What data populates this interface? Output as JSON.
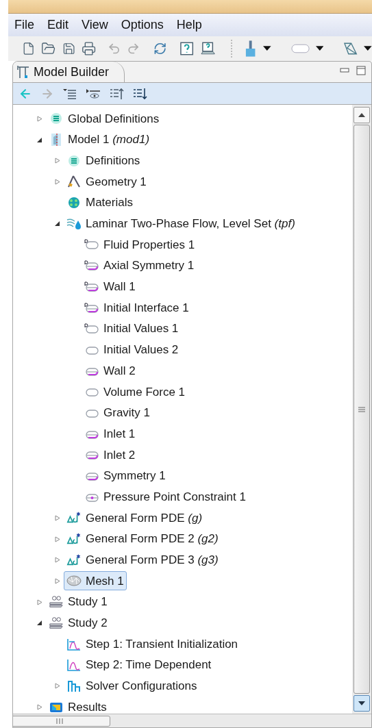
{
  "menu": [
    "File",
    "Edit",
    "View",
    "Options",
    "Help"
  ],
  "panel": {
    "title": "Model Builder"
  },
  "tree": [
    {
      "label": "Global Definitions",
      "kind": "definitions",
      "expanded": false,
      "selected": false
    },
    {
      "label": "Model 1 *(mod1)*",
      "kind": "model",
      "expanded": true,
      "selected": false,
      "children": [
        {
          "label": "Definitions",
          "kind": "definitions",
          "expanded": false,
          "selected": false
        },
        {
          "label": "Geometry 1",
          "kind": "geometry",
          "expanded": false,
          "selected": false
        },
        {
          "label": "Materials",
          "kind": "materials",
          "selected": false
        },
        {
          "label": "Laminar Two-Phase Flow, Level Set *(tpf)*",
          "kind": "physics",
          "expanded": true,
          "selected": false,
          "children": [
            {
              "label": "Fluid Properties 1",
              "kind": "node-default",
              "selected": false
            },
            {
              "label": "Axial Symmetry 1",
              "kind": "boundary-default",
              "selected": false
            },
            {
              "label": "Wall 1",
              "kind": "boundary-default",
              "selected": false
            },
            {
              "label": "Initial Interface 1",
              "kind": "boundary-default",
              "selected": false
            },
            {
              "label": "Initial Values 1",
              "kind": "node-default",
              "selected": false
            },
            {
              "label": "Initial Values 2",
              "kind": "node",
              "selected": false
            },
            {
              "label": "Wall 2",
              "kind": "boundary",
              "selected": false
            },
            {
              "label": "Volume Force 1",
              "kind": "node",
              "selected": false
            },
            {
              "label": "Gravity 1",
              "kind": "node",
              "selected": false
            },
            {
              "label": "Inlet 1",
              "kind": "boundary",
              "selected": false
            },
            {
              "label": "Inlet 2",
              "kind": "boundary",
              "selected": false
            },
            {
              "label": "Symmetry 1",
              "kind": "boundary",
              "selected": false
            },
            {
              "label": "Pressure Point Constraint 1",
              "kind": "point",
              "selected": false
            }
          ]
        },
        {
          "label": "General Form PDE *(g)*",
          "kind": "pde",
          "expanded": false,
          "selected": false
        },
        {
          "label": "General Form PDE 2 *(g2)*",
          "kind": "pde",
          "expanded": false,
          "selected": false
        },
        {
          "label": "General Form PDE 3 *(g3)*",
          "kind": "pde",
          "expanded": false,
          "selected": false
        },
        {
          "label": "Mesh 1",
          "kind": "mesh",
          "expanded": false,
          "selected": true
        }
      ]
    },
    {
      "label": "Study 1",
      "kind": "study",
      "expanded": false,
      "selected": false
    },
    {
      "label": "Study 2",
      "kind": "study",
      "expanded": true,
      "selected": false,
      "children": [
        {
          "label": "Step 1: Transient Initialization",
          "kind": "step-init",
          "selected": false
        },
        {
          "label": "Step 2: Time Dependent",
          "kind": "step-time",
          "selected": false
        },
        {
          "label": "Solver Configurations",
          "kind": "solver",
          "expanded": false,
          "selected": false
        }
      ]
    },
    {
      "label": "Results",
      "kind": "results",
      "expanded": false,
      "selected": false
    }
  ]
}
